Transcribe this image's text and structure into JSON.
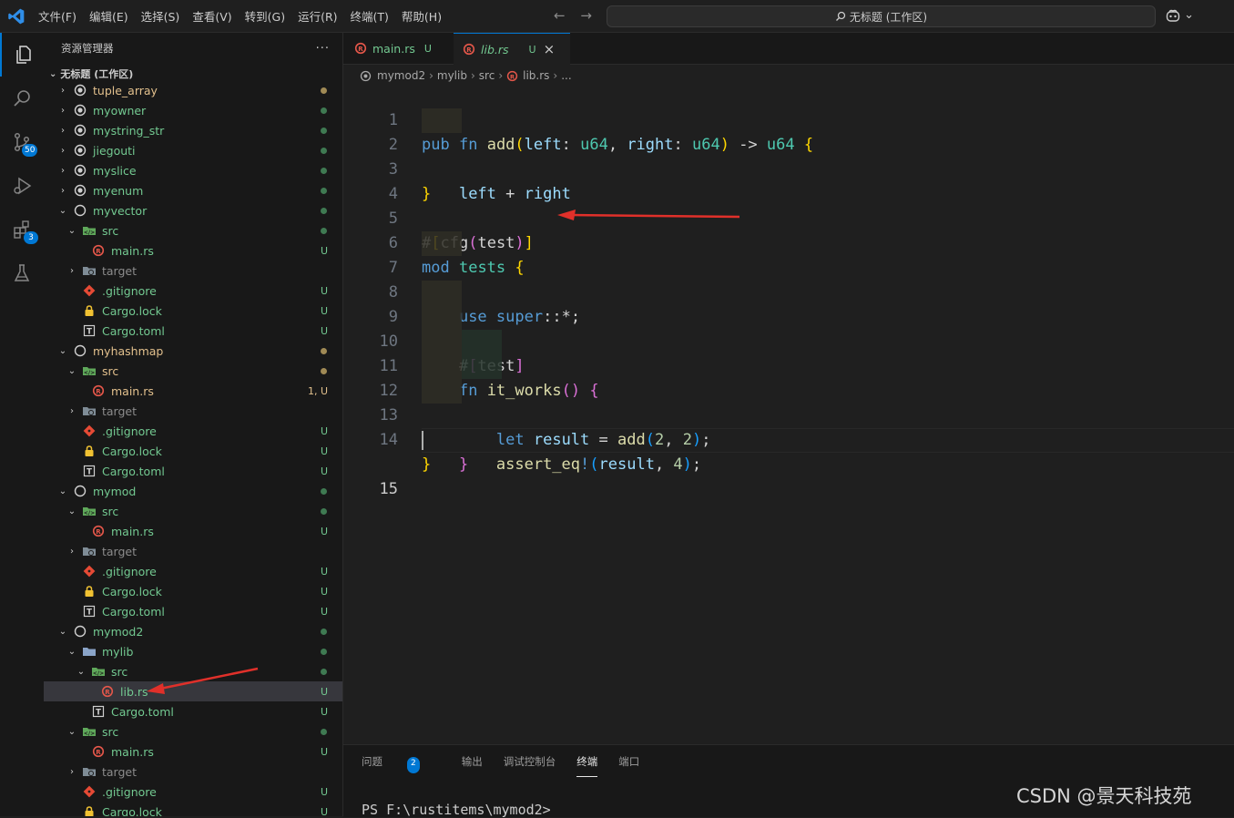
{
  "menu": [
    "文件(F)",
    "编辑(E)",
    "选择(S)",
    "查看(V)",
    "转到(G)",
    "运行(R)",
    "终端(T)",
    "帮助(H)"
  ],
  "search": {
    "text": "无标题 (工作区)"
  },
  "copilot_chevron": "⌄",
  "activity": {
    "scm_badge": "50",
    "extensions_badge": "3"
  },
  "sidebar": {
    "title": "资源管理器",
    "more": "···",
    "workspace": "无标题 (工作区)",
    "rows": [
      {
        "label": "tuple_array",
        "indent": 0,
        "chev": "›",
        "icon": "pkg",
        "color": "yellow",
        "dot": "yellow"
      },
      {
        "label": "myowner",
        "indent": 0,
        "chev": "›",
        "icon": "pkg",
        "color": "green",
        "dot": "green"
      },
      {
        "label": "mystring_str",
        "indent": 0,
        "chev": "›",
        "icon": "pkg",
        "color": "green",
        "dot": "green"
      },
      {
        "label": "jiegouti",
        "indent": 0,
        "chev": "›",
        "icon": "pkg",
        "color": "green",
        "dot": "green"
      },
      {
        "label": "myslice",
        "indent": 0,
        "chev": "›",
        "icon": "pkg",
        "color": "green",
        "dot": "green"
      },
      {
        "label": "myenum",
        "indent": 0,
        "chev": "›",
        "icon": "pkg",
        "color": "green",
        "dot": "green"
      },
      {
        "label": "myvector",
        "indent": 0,
        "chev": "⌄",
        "icon": "pkg-open",
        "color": "green",
        "dot": "green"
      },
      {
        "label": "src",
        "indent": 1,
        "chev": "⌄",
        "icon": "src",
        "color": "green",
        "dot": "green"
      },
      {
        "label": "main.rs",
        "indent": 2,
        "chev": "",
        "icon": "rust",
        "color": "green",
        "status": "U"
      },
      {
        "label": "target",
        "indent": 1,
        "chev": "›",
        "icon": "target",
        "color": "gray",
        "dot": ""
      },
      {
        "label": ".gitignore",
        "indent": 1,
        "chev": "",
        "icon": "git",
        "color": "green",
        "status": "U"
      },
      {
        "label": "Cargo.lock",
        "indent": 1,
        "chev": "",
        "icon": "lock",
        "color": "green",
        "status": "U"
      },
      {
        "label": "Cargo.toml",
        "indent": 1,
        "chev": "",
        "icon": "toml",
        "color": "green",
        "status": "U"
      },
      {
        "label": "myhashmap",
        "indent": 0,
        "chev": "⌄",
        "icon": "pkg-open",
        "color": "yellow",
        "dot": "yellow"
      },
      {
        "label": "src",
        "indent": 1,
        "chev": "⌄",
        "icon": "src",
        "color": "yellow",
        "dot": "yellow"
      },
      {
        "label": "main.rs",
        "indent": 2,
        "chev": "",
        "icon": "rust",
        "color": "yellow",
        "status": "1, U"
      },
      {
        "label": "target",
        "indent": 1,
        "chev": "›",
        "icon": "target",
        "color": "gray",
        "dot": ""
      },
      {
        "label": ".gitignore",
        "indent": 1,
        "chev": "",
        "icon": "git",
        "color": "green",
        "status": "U"
      },
      {
        "label": "Cargo.lock",
        "indent": 1,
        "chev": "",
        "icon": "lock",
        "color": "green",
        "status": "U"
      },
      {
        "label": "Cargo.toml",
        "indent": 1,
        "chev": "",
        "icon": "toml",
        "color": "green",
        "status": "U"
      },
      {
        "label": "mymod",
        "indent": 0,
        "chev": "⌄",
        "icon": "pkg-open",
        "color": "green",
        "dot": "green"
      },
      {
        "label": "src",
        "indent": 1,
        "chev": "⌄",
        "icon": "src",
        "color": "green",
        "dot": "green"
      },
      {
        "label": "main.rs",
        "indent": 2,
        "chev": "",
        "icon": "rust",
        "color": "green",
        "status": "U"
      },
      {
        "label": "target",
        "indent": 1,
        "chev": "›",
        "icon": "target",
        "color": "gray",
        "dot": ""
      },
      {
        "label": ".gitignore",
        "indent": 1,
        "chev": "",
        "icon": "git",
        "color": "green",
        "status": "U"
      },
      {
        "label": "Cargo.lock",
        "indent": 1,
        "chev": "",
        "icon": "lock",
        "color": "green",
        "status": "U"
      },
      {
        "label": "Cargo.toml",
        "indent": 1,
        "chev": "",
        "icon": "toml",
        "color": "green",
        "status": "U"
      },
      {
        "label": "mymod2",
        "indent": 0,
        "chev": "⌄",
        "icon": "pkg-open",
        "color": "green",
        "dot": "green"
      },
      {
        "label": "mylib",
        "indent": 1,
        "chev": "⌄",
        "icon": "folder",
        "color": "green",
        "dot": "green"
      },
      {
        "label": "src",
        "indent": 2,
        "chev": "⌄",
        "icon": "src",
        "color": "green",
        "dot": "green"
      },
      {
        "label": "lib.rs",
        "indent": 3,
        "chev": "",
        "icon": "rust",
        "color": "green",
        "status": "U",
        "selected": true
      },
      {
        "label": "Cargo.toml",
        "indent": 2,
        "chev": "",
        "icon": "toml",
        "color": "green",
        "status": "U"
      },
      {
        "label": "src",
        "indent": 1,
        "chev": "⌄",
        "icon": "src",
        "color": "green",
        "dot": "green"
      },
      {
        "label": "main.rs",
        "indent": 2,
        "chev": "",
        "icon": "rust",
        "color": "green",
        "status": "U"
      },
      {
        "label": "target",
        "indent": 1,
        "chev": "›",
        "icon": "target",
        "color": "gray",
        "dot": ""
      },
      {
        "label": ".gitignore",
        "indent": 1,
        "chev": "",
        "icon": "git",
        "color": "green",
        "status": "U"
      },
      {
        "label": "Cargo.lock",
        "indent": 1,
        "chev": "",
        "icon": "lock",
        "color": "green",
        "status": "U"
      }
    ]
  },
  "tabs": [
    {
      "label": "main.rs",
      "status": "U",
      "active": false
    },
    {
      "label": "lib.rs",
      "status": "U",
      "active": true,
      "close": "×"
    }
  ],
  "breadcrumb": [
    "mymod2",
    "mylib",
    "src",
    "lib.rs",
    "..."
  ],
  "code": {
    "line_numbers": [
      "1",
      "2",
      "3",
      "4",
      "5",
      "6",
      "7",
      "8",
      "9",
      "10",
      "11",
      "12",
      "13",
      "14",
      "15"
    ],
    "current_line": "15"
  },
  "panel": {
    "tabs": [
      "问题",
      "输出",
      "调试控制台",
      "终端",
      "端口"
    ],
    "problems_badge": "2",
    "active_tab": "终端",
    "terminal_prompt": "PS F:\\rustitems\\mymod2>"
  },
  "watermark": "CSDN @景天科技苑",
  "colors": {
    "accent": "#0078d4",
    "untracked": "#73c991",
    "modified": "#e2c08d",
    "annotation_arrow": "#e0302a"
  }
}
